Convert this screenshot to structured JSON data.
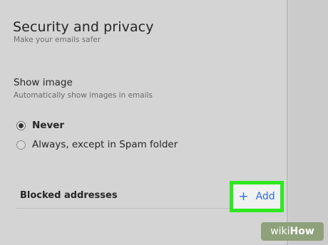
{
  "header": {
    "title": "Security and privacy",
    "subtitle": "Make your emails safer"
  },
  "show_image": {
    "heading": "Show image",
    "description": "Automatically show images in emails",
    "options": [
      {
        "label": "Never",
        "selected": true
      },
      {
        "label": "Always, except in Spam folder",
        "selected": false
      }
    ]
  },
  "blocked": {
    "label": "Blocked addresses",
    "add_icon": "plus-icon",
    "add_label": "Add"
  },
  "watermark": {
    "wiki": "wiki",
    "how": "How"
  },
  "colors": {
    "accent": "#2f6fd6",
    "highlight": "#2ee81f",
    "background": "#d4d4d4"
  }
}
